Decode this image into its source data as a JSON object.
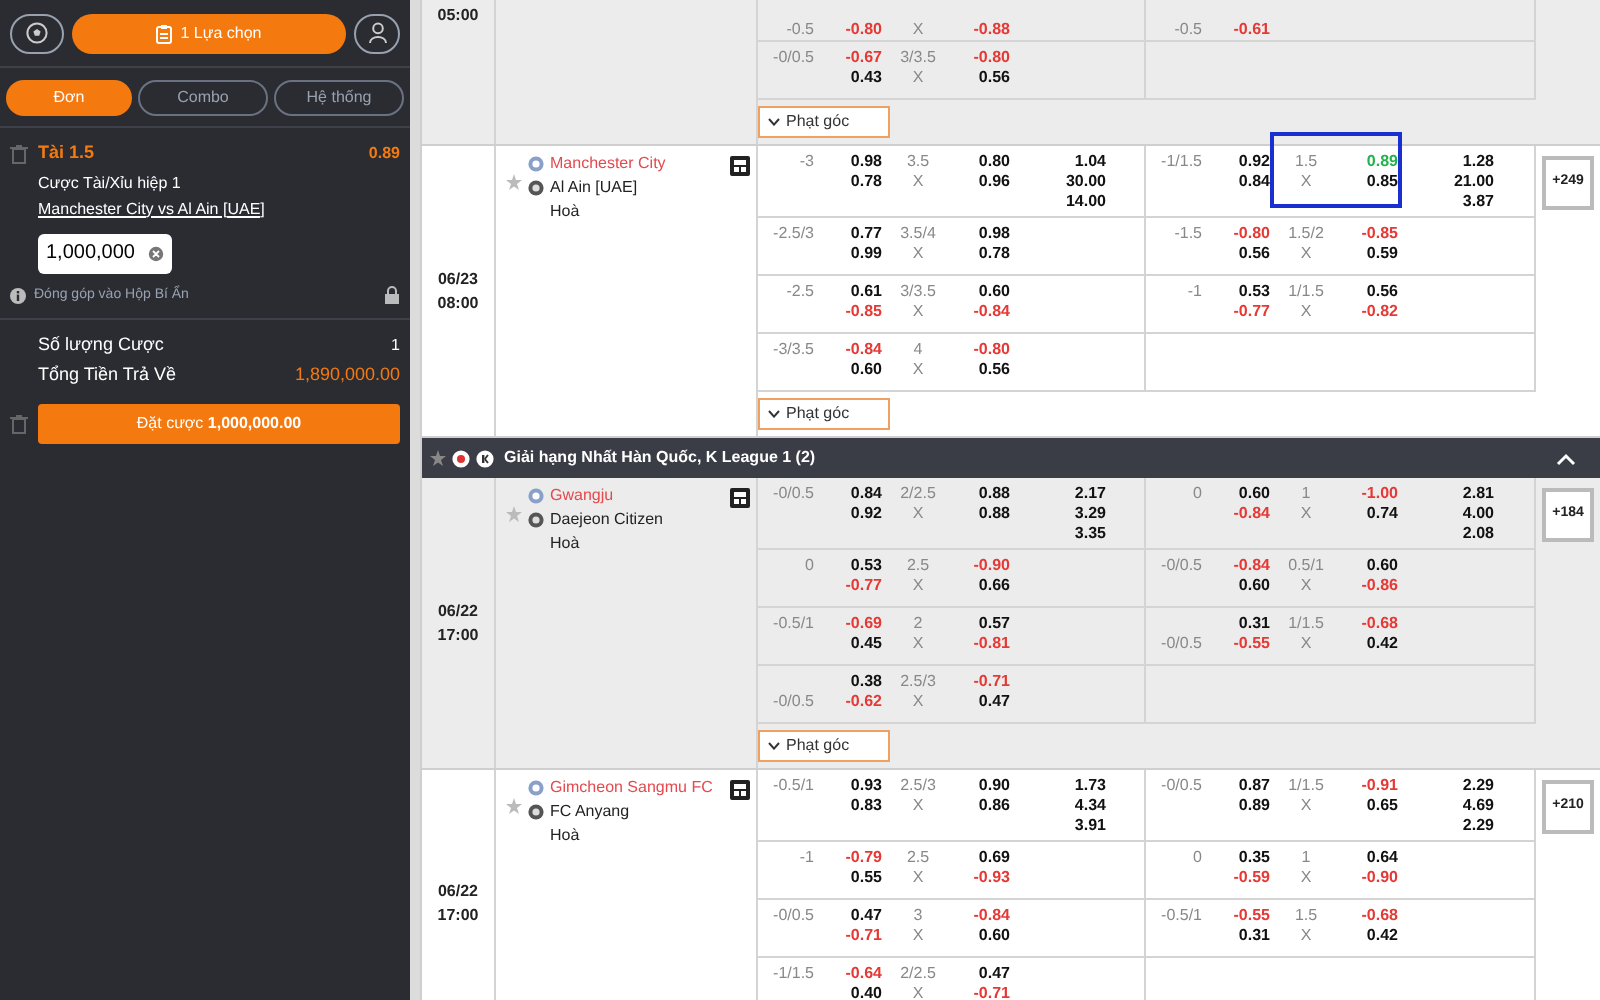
{
  "bet_slip": {
    "selection_label": "1 Lựa chọn",
    "tabs": [
      {
        "label": "Đơn",
        "selected": true
      },
      {
        "label": "Combo",
        "selected": false
      },
      {
        "label": "Hệ thống",
        "selected": false
      }
    ],
    "bet": {
      "pick": "Tài 1.5",
      "odds": "0.89",
      "market": "Cược Tài/Xỉu hiệp 1",
      "match": "Manchester City vs Al Ain [UAE]",
      "stake": "1,000,000",
      "contribution": "Đóng góp vào Hộp Bí Ẩn"
    },
    "summary": [
      {
        "kind": "count",
        "label": "Số lượng Cược",
        "value": "1"
      },
      {
        "kind": "payout",
        "label": "Tổng Tiền Trả Về",
        "value": "1,890,000.00"
      }
    ],
    "place_button": "Đặt cược **1,000,000.00**"
  },
  "blocks": [
    {
      "kind": "match",
      "shaded": true,
      "time": "05:00",
      "corner_button": "Phạt góc",
      "lines": [
        {
          "kind": "partial",
          "ft": {
            "hdp": {
              "line": "-0.5",
              "lower": true,
              "odds": [
                "-0.80"
              ]
            },
            "ou": {
              "under": "X",
              "odds": [
                "-0.88"
              ],
              "selected": false
            }
          },
          "fh": {
            "hdp": {
              "line": "-0.5",
              "lower": true,
              "odds": [
                "-0.61"
              ]
            }
          }
        },
        {
          "kind": "full",
          "ft": {
            "hdp": {
              "line": "-0/0.5",
              "lower": false,
              "odds": [
                "-0.67",
                "0.43"
              ]
            },
            "ou": {
              "line": "3/3.5",
              "under": "X",
              "odds": [
                "-0.80",
                "0.56"
              ],
              "selected": false
            }
          }
        }
      ]
    },
    {
      "kind": "match",
      "shaded": false,
      "date": "06/23",
      "time": "08:00",
      "home": "Manchester City",
      "away": "Al Ain [UAE]",
      "draw": "Hoà",
      "corner_button": "Phạt góc",
      "more": "+249",
      "lines": [
        {
          "kind": "full",
          "ft": {
            "hdp": {
              "line": "-3",
              "lower": false,
              "odds": [
                "0.98",
                "0.78"
              ]
            },
            "ou": {
              "line": "3.5",
              "under": "X",
              "odds": [
                "0.80",
                "0.96"
              ],
              "selected": false
            },
            "x12": [
              "1.04",
              "30.00",
              "14.00"
            ]
          },
          "fh": {
            "hdp": {
              "line": "-1/1.5",
              "lower": false,
              "odds": [
                "0.92",
                "0.84"
              ]
            },
            "ou": {
              "line": "1.5",
              "under": "X",
              "odds": [
                "0.89",
                "0.85"
              ],
              "selected": true
            },
            "x12": [
              "1.28",
              "21.00",
              "3.87"
            ]
          }
        },
        {
          "kind": "full",
          "ft": {
            "hdp": {
              "line": "-2.5/3",
              "lower": false,
              "odds": [
                "0.77",
                "0.99"
              ]
            },
            "ou": {
              "line": "3.5/4",
              "under": "X",
              "odds": [
                "0.98",
                "0.78"
              ],
              "selected": false
            }
          },
          "fh": {
            "hdp": {
              "line": "-1.5",
              "lower": false,
              "odds": [
                "-0.80",
                "0.56"
              ]
            },
            "ou": {
              "line": "1.5/2",
              "under": "X",
              "odds": [
                "-0.85",
                "0.59"
              ],
              "selected": false
            }
          }
        },
        {
          "kind": "full",
          "ft": {
            "hdp": {
              "line": "-2.5",
              "lower": false,
              "odds": [
                "0.61",
                "-0.85"
              ]
            },
            "ou": {
              "line": "3/3.5",
              "under": "X",
              "odds": [
                "0.60",
                "-0.84"
              ],
              "selected": false
            }
          },
          "fh": {
            "hdp": {
              "line": "-1",
              "lower": false,
              "odds": [
                "0.53",
                "-0.77"
              ]
            },
            "ou": {
              "line": "1/1.5",
              "under": "X",
              "odds": [
                "0.56",
                "-0.82"
              ],
              "selected": false
            }
          }
        },
        {
          "kind": "full",
          "ft": {
            "hdp": {
              "line": "-3/3.5",
              "lower": false,
              "odds": [
                "-0.84",
                "0.60"
              ]
            },
            "ou": {
              "line": "4",
              "under": "X",
              "odds": [
                "-0.80",
                "0.56"
              ],
              "selected": false
            }
          }
        }
      ]
    },
    {
      "kind": "league",
      "title": "Giải hạng Nhất Hàn Quốc, K League 1 (2)",
      "expanded": true
    },
    {
      "kind": "match",
      "shaded": true,
      "date": "06/22",
      "time": "17:00",
      "home": "Gwangju",
      "away": "Daejeon Citizen",
      "draw": "Hoà",
      "corner_button": "Phạt góc",
      "more": "+184",
      "lines": [
        {
          "kind": "full",
          "ft": {
            "hdp": {
              "line": "-0/0.5",
              "lower": false,
              "odds": [
                "0.84",
                "0.92"
              ]
            },
            "ou": {
              "line": "2/2.5",
              "under": "X",
              "odds": [
                "0.88",
                "0.88"
              ],
              "selected": false
            },
            "x12": [
              "2.17",
              "3.29",
              "3.35"
            ]
          },
          "fh": {
            "hdp": {
              "line": "0",
              "lower": false,
              "odds": [
                "0.60",
                "-0.84"
              ]
            },
            "ou": {
              "line": "1",
              "under": "X",
              "odds": [
                "-1.00",
                "0.74"
              ],
              "selected": false
            },
            "x12": [
              "2.81",
              "4.00",
              "2.08"
            ]
          }
        },
        {
          "kind": "full",
          "ft": {
            "hdp": {
              "line": "0",
              "lower": false,
              "odds": [
                "0.53",
                "-0.77"
              ]
            },
            "ou": {
              "line": "2.5",
              "under": "X",
              "odds": [
                "-0.90",
                "0.66"
              ],
              "selected": false
            }
          },
          "fh": {
            "hdp": {
              "line": "-0/0.5",
              "lower": false,
              "odds": [
                "-0.84",
                "0.60"
              ]
            },
            "ou": {
              "line": "0.5/1",
              "under": "X",
              "odds": [
                "0.60",
                "-0.86"
              ],
              "selected": false
            }
          }
        },
        {
          "kind": "full",
          "ft": {
            "hdp": {
              "line": "-0.5/1",
              "lower": false,
              "odds": [
                "-0.69",
                "0.45"
              ]
            },
            "ou": {
              "line": "2",
              "under": "X",
              "odds": [
                "0.57",
                "-0.81"
              ],
              "selected": false
            }
          },
          "fh": {
            "hdp": {
              "line": "-0/0.5",
              "lower": true,
              "odds": [
                "0.31",
                "-0.55"
              ]
            },
            "ou": {
              "line": "1/1.5",
              "under": "X",
              "odds": [
                "-0.68",
                "0.42"
              ],
              "selected": false
            }
          }
        },
        {
          "kind": "full",
          "ft": {
            "hdp": {
              "line": "-0/0.5",
              "lower": true,
              "odds": [
                "0.38",
                "-0.62"
              ]
            },
            "ou": {
              "line": "2.5/3",
              "under": "X",
              "odds": [
                "-0.71",
                "0.47"
              ],
              "selected": false
            }
          }
        }
      ]
    },
    {
      "kind": "match",
      "shaded": false,
      "date": "06/22",
      "time": "17:00",
      "home": "Gimcheon Sangmu FC",
      "away": "FC Anyang",
      "draw": "Hoà",
      "more": "+210",
      "lines": [
        {
          "kind": "full",
          "ft": {
            "hdp": {
              "line": "-0.5/1",
              "lower": false,
              "odds": [
                "0.93",
                "0.83"
              ]
            },
            "ou": {
              "line": "2.5/3",
              "under": "X",
              "odds": [
                "0.90",
                "0.86"
              ],
              "selected": false
            },
            "x12": [
              "1.73",
              "4.34",
              "3.91"
            ]
          },
          "fh": {
            "hdp": {
              "line": "-0/0.5",
              "lower": false,
              "odds": [
                "0.87",
                "0.89"
              ]
            },
            "ou": {
              "line": "1/1.5",
              "under": "X",
              "odds": [
                "-0.91",
                "0.65"
              ],
              "selected": false
            },
            "x12": [
              "2.29",
              "4.69",
              "2.29"
            ]
          }
        },
        {
          "kind": "full",
          "ft": {
            "hdp": {
              "line": "-1",
              "lower": false,
              "odds": [
                "-0.79",
                "0.55"
              ]
            },
            "ou": {
              "line": "2.5",
              "under": "X",
              "odds": [
                "0.69",
                "-0.93"
              ],
              "selected": false
            }
          },
          "fh": {
            "hdp": {
              "line": "0",
              "lower": false,
              "odds": [
                "0.35",
                "-0.59"
              ]
            },
            "ou": {
              "line": "1",
              "under": "X",
              "odds": [
                "0.64",
                "-0.90"
              ],
              "selected": false
            }
          }
        },
        {
          "kind": "full",
          "ft": {
            "hdp": {
              "line": "-0/0.5",
              "lower": false,
              "odds": [
                "0.47",
                "-0.71"
              ]
            },
            "ou": {
              "line": "3",
              "under": "X",
              "odds": [
                "-0.84",
                "0.60"
              ],
              "selected": false
            }
          },
          "fh": {
            "hdp": {
              "line": "-0.5/1",
              "lower": false,
              "odds": [
                "-0.55",
                "0.31"
              ]
            },
            "ou": {
              "line": "1.5",
              "under": "X",
              "odds": [
                "-0.68",
                "0.42"
              ],
              "selected": false
            }
          }
        },
        {
          "kind": "full",
          "ft": {
            "hdp": {
              "line": "-1/1.5",
              "lower": false,
              "odds": [
                "-0.64",
                "0.40"
              ]
            },
            "ou": {
              "line": "2/2.5",
              "under": "X",
              "odds": [
                "0.47",
                "-0.71"
              ],
              "selected": false
            }
          }
        }
      ]
    }
  ]
}
